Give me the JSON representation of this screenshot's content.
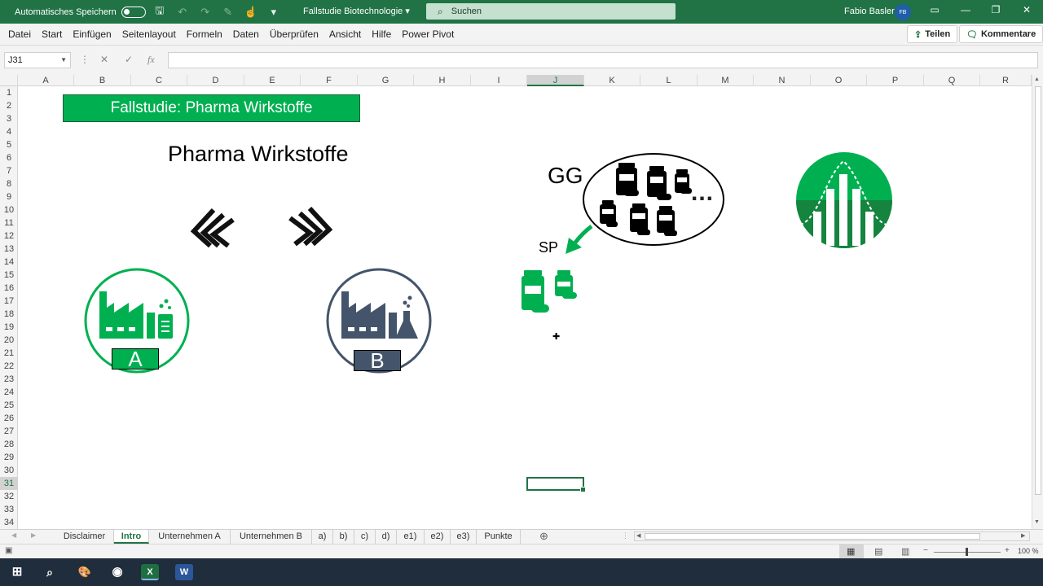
{
  "window": {
    "autosave_label": "Automatisches Speichern",
    "doc_title": "Fallstudie Biotechnologie",
    "search_placeholder": "Suchen",
    "user_name": "Fabio Basler",
    "user_initials": "FB"
  },
  "ribbon": {
    "tabs": [
      "Datei",
      "Start",
      "Einfügen",
      "Seitenlayout",
      "Formeln",
      "Daten",
      "Überprüfen",
      "Ansicht",
      "Hilfe",
      "Power Pivot"
    ],
    "share_label": "Teilen",
    "comments_label": "Kommentare"
  },
  "formula_bar": {
    "name_box": "J31",
    "fx": "fx",
    "cancel": "✕",
    "confirm": "✓",
    "value": ""
  },
  "grid": {
    "columns": [
      "A",
      "B",
      "C",
      "D",
      "E",
      "F",
      "G",
      "H",
      "I",
      "J",
      "K",
      "L",
      "M",
      "N",
      "O",
      "P",
      "Q",
      "R"
    ],
    "selected_column": "J",
    "rows": [
      "1",
      "2",
      "3",
      "4",
      "5",
      "6",
      "7",
      "8",
      "9",
      "10",
      "11",
      "12",
      "13",
      "14",
      "15",
      "16",
      "17",
      "18",
      "19",
      "20",
      "21",
      "22",
      "23",
      "24",
      "25",
      "26",
      "27",
      "28",
      "29",
      "30",
      "31",
      "32",
      "33",
      "34"
    ],
    "selected_row": "31"
  },
  "sheet": {
    "title": "Fallstudie: Pharma Wirkstoffe",
    "heading": "Pharma Wirkstoffe",
    "label_gg": "GG",
    "ellipsis": "...",
    "label_sp": "SP",
    "factory_a_label": "A",
    "factory_b_label": "B"
  },
  "sheet_tabs": [
    "Disclaimer",
    "Intro",
    "Unternehmen A",
    "Unternehmen B",
    "a)",
    "b)",
    "c)",
    "d)",
    "e1)",
    "e2)",
    "e3)",
    "Punkte"
  ],
  "active_sheet": "Intro",
  "status": {
    "zoom": "100 %"
  },
  "colors": {
    "excel_green": "#217346",
    "accent_green": "#00b050",
    "slate": "#44546a"
  }
}
